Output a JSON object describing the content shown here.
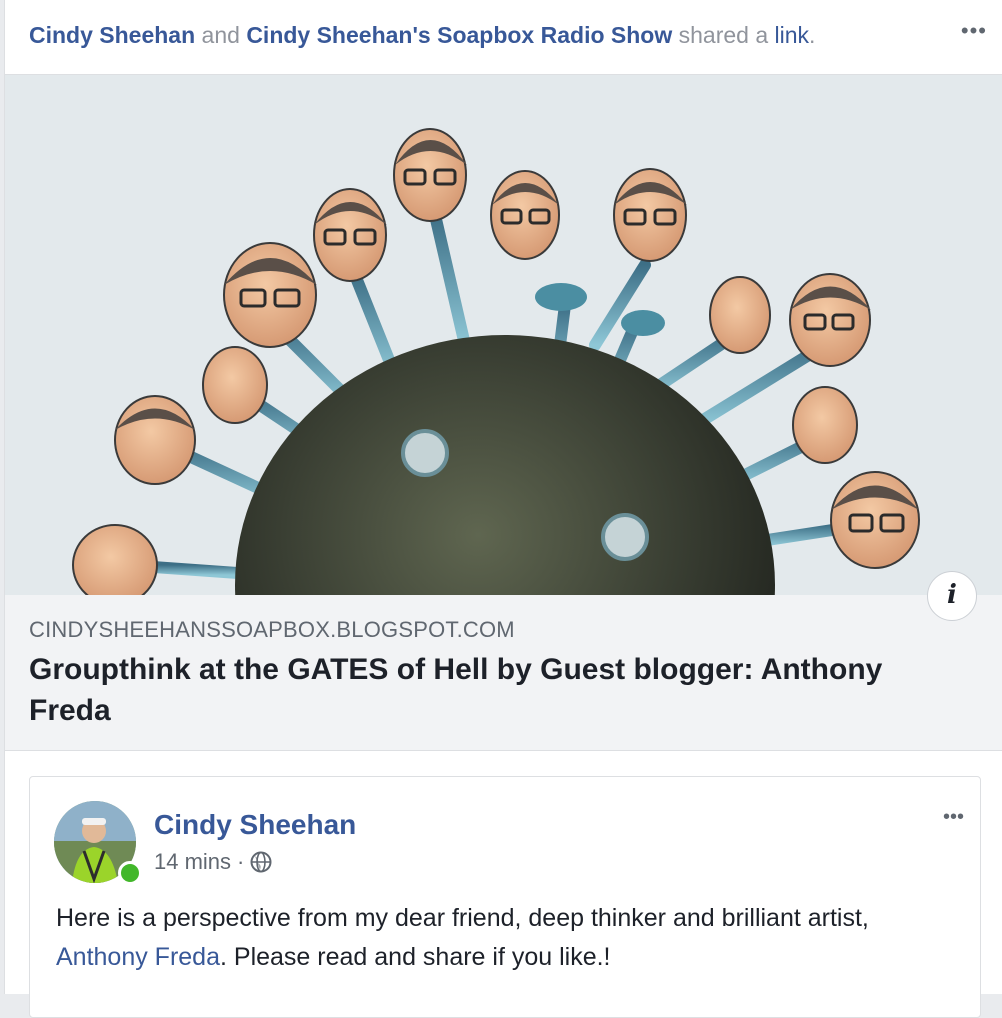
{
  "header": {
    "author1": "Cindy Sheehan",
    "and": "and",
    "author2": "Cindy Sheehan's Soapbox Radio Show",
    "shared": "shared a",
    "link_word": "link",
    "period": ".",
    "more_icon": "more-horizontal-icon",
    "more_label": "•••"
  },
  "link_preview": {
    "domain": "CINDYSHEEHANSSOAPBOX.BLOGSPOT.COM",
    "title": "Groupthink at the GATES of Hell by Guest blogger: Anthony Freda",
    "info_label": "i"
  },
  "original_post": {
    "author": "Cindy Sheehan",
    "time": "14 mins",
    "separator": "·",
    "privacy_icon": "globe-icon",
    "more_label": "•••",
    "text_before": "Here is a perspective from my dear friend, deep thinker and brilliant artist, ",
    "mention": "Anthony Freda",
    "text_after": ". Please read and share if you like.!"
  },
  "colors": {
    "link": "#385898",
    "muted": "#90949c",
    "online": "#42b72a"
  }
}
